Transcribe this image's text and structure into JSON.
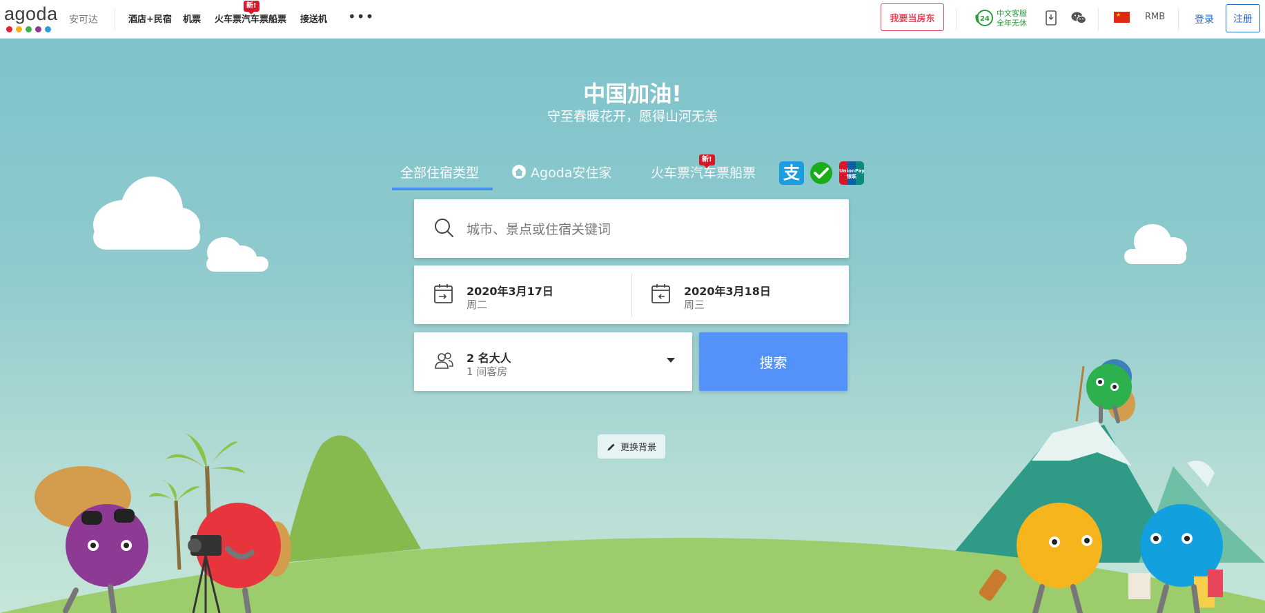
{
  "brand": {
    "logo_text": "agoda",
    "logo_dot_colors": [
      "#e8252f",
      "#f5b11c",
      "#3cb14a",
      "#8e3a95",
      "#2a9ed8"
    ],
    "chinese_name": "安可达"
  },
  "nav": {
    "items": [
      "酒店+民宿",
      "机票",
      "火车票汽车票船票",
      "接送机"
    ],
    "new_badge": "新!",
    "more_label": "•••"
  },
  "header_right": {
    "host_label": "我要当房东",
    "support_line1": "中文客服",
    "support_line2": "全年无休",
    "support_icon_text": "24",
    "currency": "RMB",
    "login_label": "登录",
    "signup_label": "注册"
  },
  "hero": {
    "headline": "中国加油!",
    "subline": "守至春暖花开，愿得山河无恙"
  },
  "tabs": {
    "all_stays": "全部住宿类型",
    "homes": "Agoda安住家",
    "transport": "火车票汽车票船票",
    "new_badge": "新!"
  },
  "payment_methods": {
    "alipay": "支",
    "unionpay_en": "UnionPay",
    "unionpay_cn": "银联"
  },
  "search": {
    "placeholder": "城市、景点或住宿关键词"
  },
  "dates": {
    "checkin": {
      "date": "2020年3月17日",
      "weekday": "周二"
    },
    "checkout": {
      "date": "2020年3月18日",
      "weekday": "周三"
    }
  },
  "guests": {
    "adults": "2 名大人",
    "rooms": "1 间客房"
  },
  "search_button": "搜索",
  "change_background": "更换背景",
  "colors": {
    "accent_blue": "#5392f9",
    "link_blue": "#2567d0",
    "host_red": "#e8465a",
    "badge_red": "#d6192a",
    "support_green": "#2a9d3c"
  }
}
